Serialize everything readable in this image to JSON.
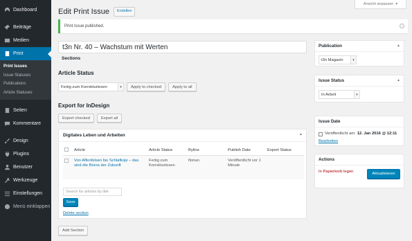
{
  "sidebar": {
    "items_top": [
      {
        "label": "Dashboard",
        "icon": "dashboard-icon"
      },
      {
        "label": "Beiträge",
        "icon": "pin-icon"
      },
      {
        "label": "Medien",
        "icon": "media-icon"
      },
      {
        "label": "Print",
        "icon": "document-icon"
      }
    ],
    "submenu": [
      "Print Issues",
      "Issue Statuses",
      "Publications",
      "Article Statuses"
    ],
    "items_bottom": [
      {
        "label": "Seiten",
        "icon": "page-icon"
      },
      {
        "label": "Kommentare",
        "icon": "comment-icon"
      },
      {
        "label": "Design",
        "icon": "brush-icon"
      },
      {
        "label": "Plugins",
        "icon": "plugin-icon"
      },
      {
        "label": "Benutzer",
        "icon": "user-icon"
      },
      {
        "label": "Werkzeuge",
        "icon": "wrench-icon"
      },
      {
        "label": "Einstellungen",
        "icon": "settings-icon"
      },
      {
        "label": "Menü einklappen",
        "icon": "collapse-icon"
      }
    ]
  },
  "header": {
    "screen_options": "Ansicht anpassen",
    "title": "Edit Print Issue",
    "add_new": "Erstellen"
  },
  "notice": {
    "text": "Print Issue published."
  },
  "issue": {
    "title": "t3n Nr. 40 – Wachstum mit Werten",
    "sections_label": "Sections"
  },
  "article_status": {
    "heading": "Article Status",
    "select_value": "Fertig zum Korrekturlesen",
    "apply_checked": "Apply to checked",
    "apply_all": "Apply to all"
  },
  "export": {
    "heading": "Export for InDesign",
    "export_checked": "Export checked",
    "export_all": "Export all"
  },
  "section": {
    "title": "Digitales Leben und Arbeiten",
    "columns": [
      "Article",
      "Article Status",
      "Byline",
      "Publish Date",
      "Export Status"
    ],
    "row": {
      "article": "Von Affenfelsen bis Schlafkoje – das sind die Büros der Zukunft",
      "status": "Fertig zum Korrekturlesen",
      "byline": "florian",
      "publish_date": "Veröffentlicht vor 1 Minute",
      "export_status": ""
    },
    "search_placeholder": "Search for articles by title",
    "save": "Save",
    "delete": "Delete section"
  },
  "add_section": "Add Section",
  "publication_box": {
    "title": "Publication",
    "value": "t3n Magazin"
  },
  "issue_status_box": {
    "title": "Issue Status",
    "value": "In Arbeit"
  },
  "issue_date_box": {
    "title": "Issue Date",
    "prefix": "Veröffentlicht am:",
    "date": "12. Jan 2016 @ 12:11",
    "edit": "Bearbeiten"
  },
  "actions_box": {
    "title": "Actions",
    "trash": "In Papierkorb legen",
    "update": "Aktualisieren"
  },
  "colors": {
    "sidebar": "#23282d",
    "accent": "#0073aa",
    "primary_button": "#0085ba",
    "notice_success": "#46b450"
  }
}
